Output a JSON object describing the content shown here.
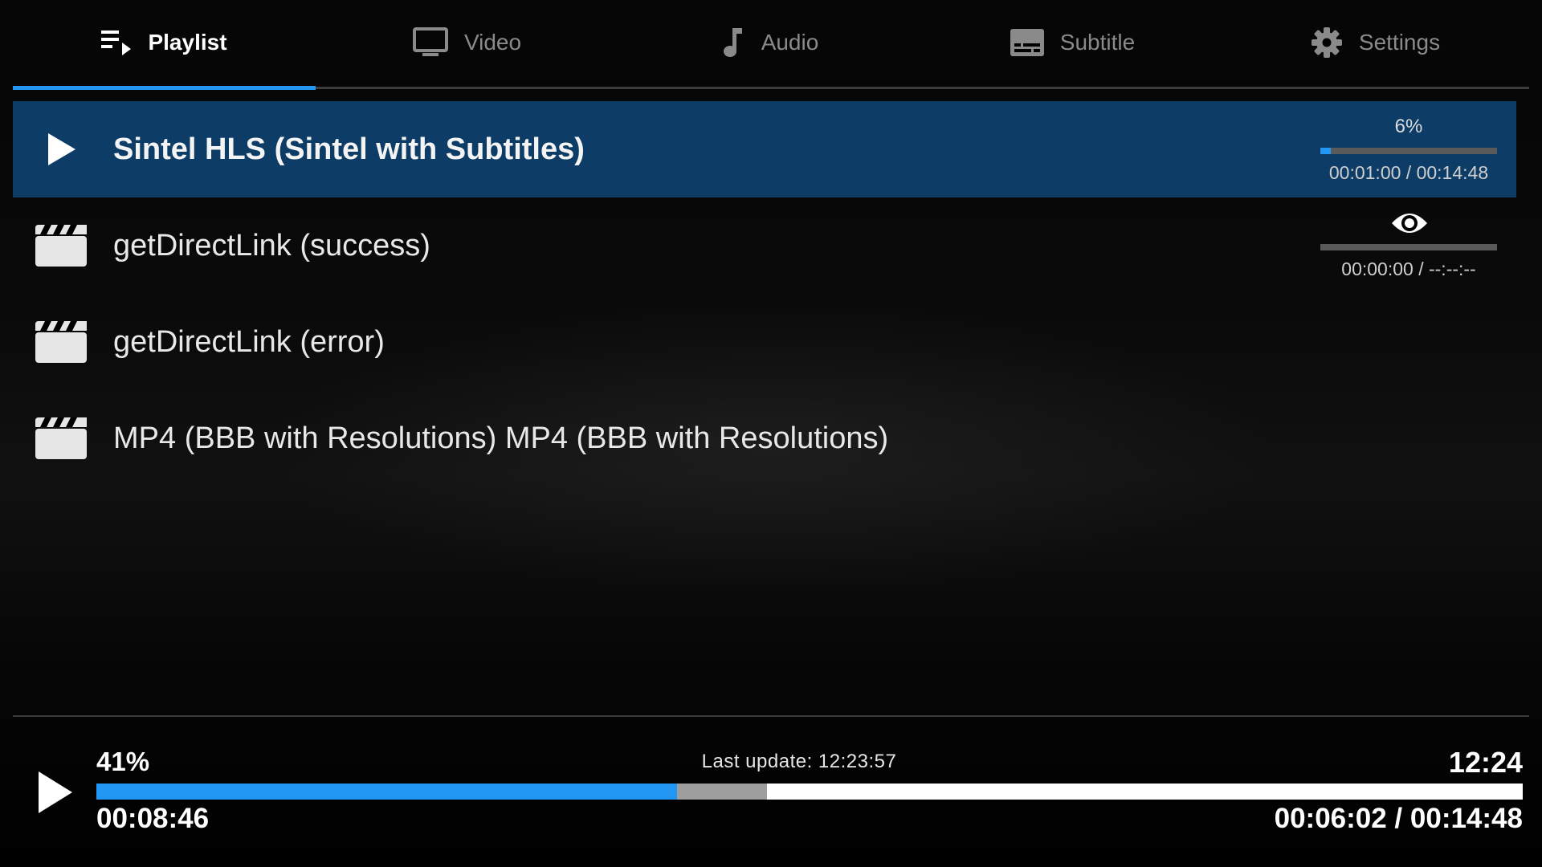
{
  "tabs": [
    {
      "label": "Playlist",
      "icon": "playlist-icon",
      "active": true
    },
    {
      "label": "Video",
      "icon": "tv-icon",
      "active": false
    },
    {
      "label": "Audio",
      "icon": "music-note-icon",
      "active": false
    },
    {
      "label": "Subtitle",
      "icon": "subtitles-icon",
      "active": false
    },
    {
      "label": "Settings",
      "icon": "gear-icon",
      "active": false
    }
  ],
  "playlist": [
    {
      "title": "Sintel HLS (Sintel with Subtitles)",
      "icon": "play-icon",
      "selected": true,
      "percent": "6%",
      "progress": 0.06,
      "time": "00:01:00 / 00:14:48"
    },
    {
      "title": "getDirectLink (success)",
      "icon": "clapperboard-icon",
      "selected": false,
      "status_icon": "eye-icon",
      "progress": 0,
      "time": "00:00:00 / --:--:--"
    },
    {
      "title": "getDirectLink (error)",
      "icon": "clapperboard-icon",
      "selected": false
    },
    {
      "title": "MP4 (BBB with Resolutions) MP4 (BBB with Resolutions)",
      "icon": "clapperboard-icon",
      "selected": false
    }
  ],
  "player": {
    "percent": "41%",
    "last_update": "Last update: 12:23:57",
    "clock": "12:24",
    "elapsed": "00:08:46",
    "position_duration": "00:06:02 / 00:14:48",
    "played_fraction": 0.407,
    "buffered_fraction": 0.47
  },
  "colors": {
    "accent": "#2196f3",
    "selected_row": "#0d3d66",
    "buffer": "#9e9e9e"
  }
}
